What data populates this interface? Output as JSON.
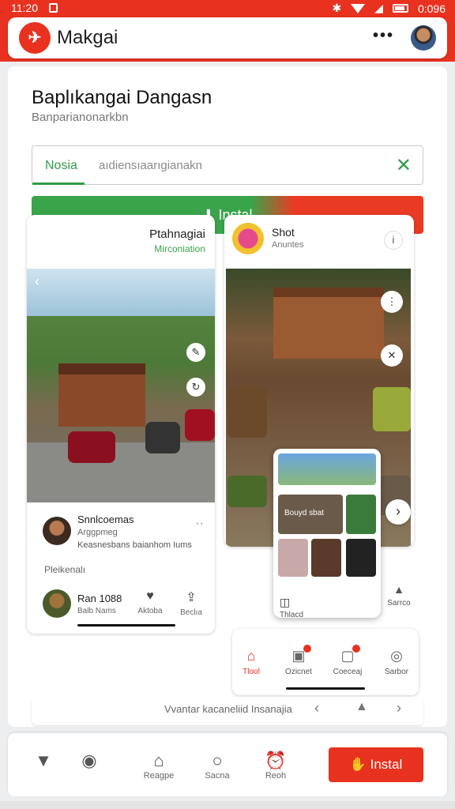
{
  "status": {
    "time": "11:20",
    "right_text": "0:096"
  },
  "app": {
    "name": "Makgai"
  },
  "page": {
    "title": "Baplıkangai Dangasn",
    "subtitle": "Banparianonarkbn"
  },
  "search": {
    "tag": "Nosia",
    "placeholder": "aıdiensıaarıgianakn"
  },
  "install_main": {
    "label": "Instal"
  },
  "card1": {
    "title": "Ptahnagiai",
    "subtitle": "Mirconiation",
    "post": {
      "name": "Snnlcoemas",
      "handle": "Arggpmeg",
      "desc": "Keasnesbans baianhom Iums"
    },
    "section": "Pleikenalı",
    "author2": {
      "name": "Ran 1088",
      "meta": "Balb Nams"
    },
    "actions": [
      "Aktoba",
      "Beclıa"
    ]
  },
  "card2": {
    "title": "Shot",
    "subtitle": "Anuntes",
    "popup": {
      "tile_text": "Bouyd sbat",
      "foot_left": "Thlacd",
      "foot_right": "Sarrco"
    }
  },
  "mini_nav": [
    {
      "label": "Tlool",
      "active": true
    },
    {
      "label": "Ozicnet"
    },
    {
      "label": "Coeceaj"
    },
    {
      "label": "Sarbor"
    }
  ],
  "pager": {
    "text": "Vvantar kacaneliid Insanajia"
  },
  "bottom_nav": [
    {
      "label": "Reagpe"
    },
    {
      "label": "Sacna"
    },
    {
      "label": "Reoh"
    }
  ],
  "install_bottom": {
    "label": "Instal"
  },
  "colors": {
    "brand_red": "#e8321f",
    "brand_green": "#3aa44a"
  }
}
